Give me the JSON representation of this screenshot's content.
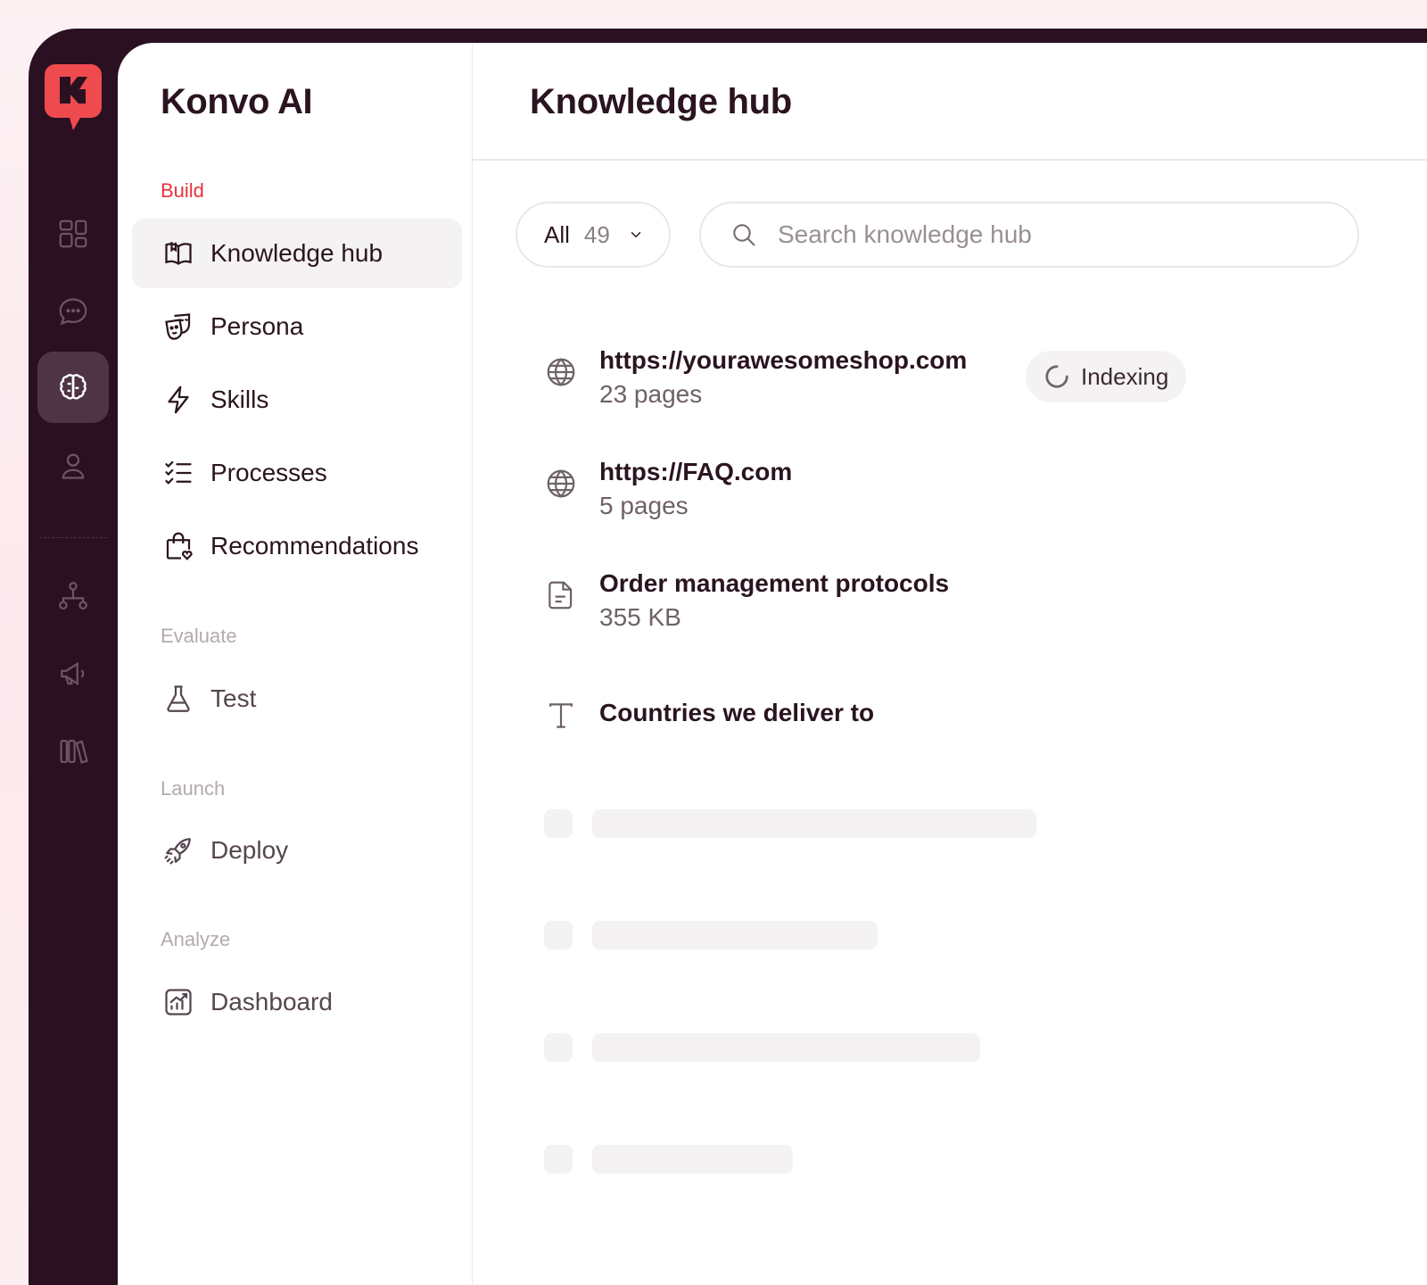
{
  "app": {
    "name": "Konvo AI",
    "accent": "#e8323c",
    "rail_bg": "#2a1020"
  },
  "rail": {
    "items": [
      {
        "name": "dashboard-grid",
        "active": false
      },
      {
        "name": "chat",
        "active": false
      },
      {
        "name": "brain",
        "active": true
      },
      {
        "name": "user",
        "active": false
      },
      {
        "name": "hierarchy",
        "active": false
      },
      {
        "name": "megaphone",
        "active": false
      },
      {
        "name": "library",
        "active": false
      }
    ]
  },
  "sidebar": {
    "sections": [
      {
        "label": "Build",
        "active": true,
        "items": [
          {
            "label": "Knowledge hub",
            "icon": "book-open-icon",
            "active": true
          },
          {
            "label": "Persona",
            "icon": "theater-masks-icon"
          },
          {
            "label": "Skills",
            "icon": "lightning-icon"
          },
          {
            "label": "Processes",
            "icon": "checklist-icon"
          },
          {
            "label": "Recommendations",
            "icon": "shopping-bag-heart-icon"
          }
        ]
      },
      {
        "label": "Evaluate",
        "items": [
          {
            "label": "Test",
            "icon": "flask-icon"
          }
        ]
      },
      {
        "label": "Launch",
        "items": [
          {
            "label": "Deploy",
            "icon": "rocket-icon"
          }
        ]
      },
      {
        "label": "Analyze",
        "items": [
          {
            "label": "Dashboard",
            "icon": "chart-icon"
          }
        ]
      }
    ]
  },
  "main": {
    "title": "Knowledge hub",
    "filter": {
      "label": "All",
      "count": "49"
    },
    "search": {
      "placeholder": "Search knowledge hub",
      "value": ""
    },
    "items": [
      {
        "title": "https://yourawesomeshop.com",
        "subtitle": "23 pages",
        "icon": "globe-icon",
        "status": "Indexing"
      },
      {
        "title": "https://FAQ.com",
        "subtitle": "5 pages",
        "icon": "globe-icon"
      },
      {
        "title": "Order management protocols",
        "subtitle": "355 KB",
        "icon": "file-icon"
      },
      {
        "title": "Countries we deliver to",
        "icon": "text-icon"
      }
    ]
  }
}
